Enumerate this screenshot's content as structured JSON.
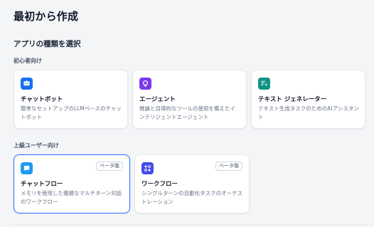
{
  "page": {
    "title": "最初から作成"
  },
  "app_type_section": {
    "title": "アプリの種類を選択"
  },
  "beginner": {
    "label": "初心者向け",
    "cards": [
      {
        "title": "チャットボット",
        "description": "簡単なセットアップのLLMベースのチャットボット",
        "icon": "chat-bot-icon",
        "color": "#1570ef"
      },
      {
        "title": "エージェント",
        "description": "推論と自律的なツールの使用を備えたインテリジェントエージェント",
        "icon": "agent-icon",
        "color": "#7839ee"
      },
      {
        "title": "テキスト ジェネレーター",
        "description": "テキスト生成タスクのためのAIアシスタント",
        "icon": "text-generator-icon",
        "color": "#0e9384"
      }
    ]
  },
  "advanced": {
    "label": "上級ユーザー向け",
    "cards": [
      {
        "title": "チャットフロー",
        "description": "メモリを使用した複雑なマルチターン対話のワークフロー",
        "badge": "ベータ版",
        "icon": "chatflow-icon",
        "color": "#1d9bf0",
        "selected": true
      },
      {
        "title": "ワークフロー",
        "description": "シングルターンの自動化タスクのオーケストレーション",
        "badge": "ベータ版",
        "icon": "workflow-icon",
        "color": "#444ce7"
      }
    ]
  }
}
